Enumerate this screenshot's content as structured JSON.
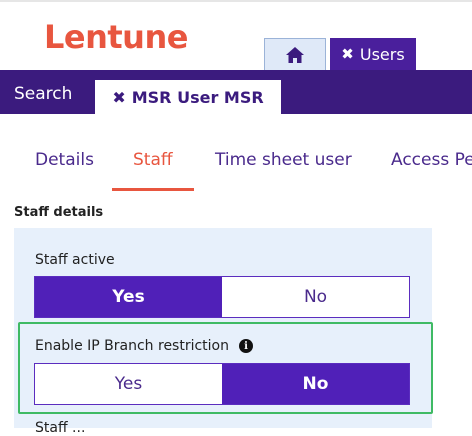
{
  "app": {
    "logo_text": "Lentune"
  },
  "window_tabs": {
    "users_label": "Users"
  },
  "navbar": {
    "search_label": "Search",
    "active_tab_label": "MSR User MSR"
  },
  "subtabs": [
    "Details",
    "Staff",
    "Time sheet user",
    "Access Pe"
  ],
  "staff_details": {
    "section_title": "Staff details",
    "staff_active": {
      "label": "Staff active",
      "options": [
        "Yes",
        "No"
      ],
      "selected": "Yes"
    },
    "ip_restriction": {
      "label": "Enable IP Branch restriction",
      "info_icon": "i",
      "options": [
        "Yes",
        "No"
      ],
      "selected": "No"
    },
    "next_field_label": "Staff ..."
  },
  "colors": {
    "brand": "#e8563f",
    "nav_bg": "#3b1b7e",
    "toggle_selected": "#5020b8",
    "highlight": "#3fba64"
  }
}
